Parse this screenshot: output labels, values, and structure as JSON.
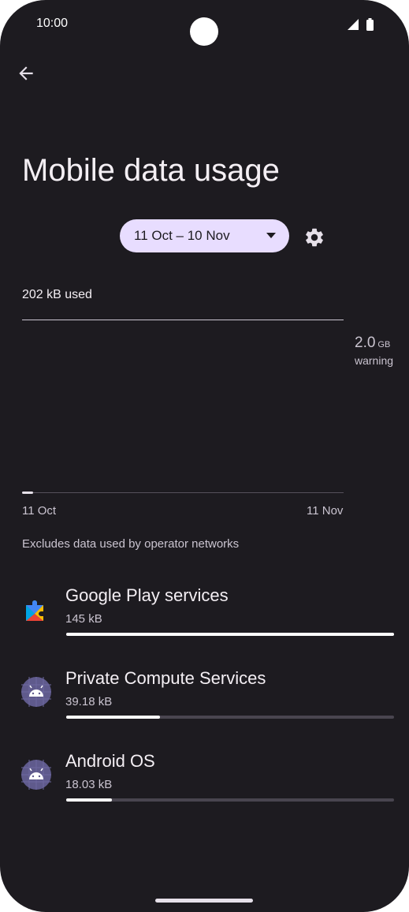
{
  "status_bar": {
    "time": "10:00"
  },
  "header": {
    "title": "Mobile data usage"
  },
  "cycle": {
    "selected": "11 Oct – 10 Nov"
  },
  "summary": {
    "used_text": "202 kB used"
  },
  "chart": {
    "warning_value": "2.0",
    "warning_unit": "GB",
    "warning_label": "warning",
    "start_date": "11 Oct",
    "end_date": "11 Nov",
    "usage_fraction": 0.0001
  },
  "note": "Excludes data used by operator networks",
  "apps": [
    {
      "name": "Google Play services",
      "size": "145 kB",
      "fraction": 1.0
    },
    {
      "name": "Private Compute Services",
      "size": "39.18 kB",
      "fraction": 0.285
    },
    {
      "name": "Android OS",
      "size": "18.03 kB",
      "fraction": 0.14
    }
  ],
  "icons": {
    "back": "back-arrow-icon",
    "dropdown": "dropdown-caret-icon",
    "settings": "gear-icon",
    "play_services": "google-play-services-icon",
    "android": "android-icon"
  },
  "colors": {
    "background": "#1d1b20",
    "pill": "#e8ddff",
    "bar_fill": "#ffffff",
    "bar_track": "#49454f"
  }
}
